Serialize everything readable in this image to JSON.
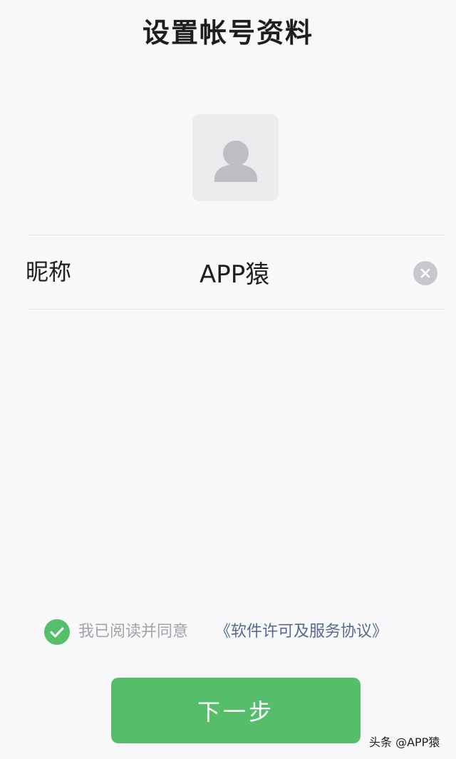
{
  "header": {
    "title": "设置帐号资料"
  },
  "avatar": {
    "icon": "default-user-avatar",
    "background_color": "#ECECEE"
  },
  "nickname": {
    "label": "昵称",
    "value": "APP猿",
    "clear_icon": "clear-circle-icon"
  },
  "agreement": {
    "checked": true,
    "check_icon": "check-circle-icon",
    "text": "我已阅读并同意",
    "link_text": "《软件许可及服务协议》",
    "link_color": "#58698F"
  },
  "footer": {
    "next_button_label": "下一步",
    "button_color": "#56BE6A"
  },
  "watermark": {
    "text": "头条 @APP猿"
  }
}
